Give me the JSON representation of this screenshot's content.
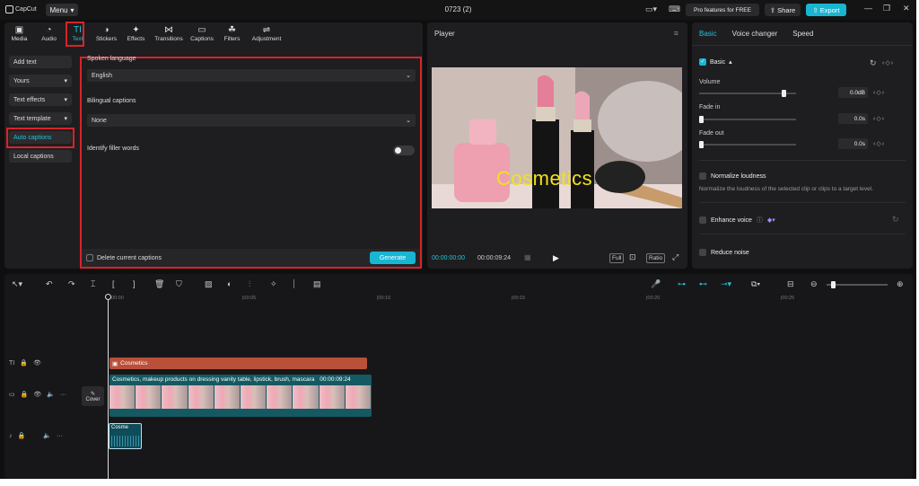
{
  "app": {
    "logo_text": "CapCut",
    "menu_label": "Menu",
    "doc_title": "0723 (2)"
  },
  "header": {
    "pro_label": "Pro features for FREE",
    "share_label": "Share",
    "export_label": "Export"
  },
  "tool_tabs": [
    {
      "label": "Media",
      "icon": "media-icon",
      "glyph": "▣"
    },
    {
      "label": "Audio",
      "icon": "audio-icon",
      "glyph": "◔"
    },
    {
      "label": "Text",
      "icon": "text-icon",
      "glyph": "TI"
    },
    {
      "label": "Stickers",
      "icon": "stickers-icon",
      "glyph": "◑"
    },
    {
      "label": "Effects",
      "icon": "effects-icon",
      "glyph": "✦"
    },
    {
      "label": "Transitions",
      "icon": "transitions-icon",
      "glyph": "⋈"
    },
    {
      "label": "Captions",
      "icon": "captions-icon",
      "glyph": "▭"
    },
    {
      "label": "Filters",
      "icon": "filters-icon",
      "glyph": "☘"
    },
    {
      "label": "Adjustment",
      "icon": "adjustment-icon",
      "glyph": "⇌"
    }
  ],
  "side_menu": [
    {
      "label": "Add text",
      "dropdown": false
    },
    {
      "label": "Yours",
      "dropdown": true
    },
    {
      "label": "Text effects",
      "dropdown": true
    },
    {
      "label": "Text template",
      "dropdown": true
    },
    {
      "label": "Auto captions",
      "dropdown": false,
      "active": true
    },
    {
      "label": "Local captions",
      "dropdown": false
    }
  ],
  "captions": {
    "spoken_label": "Spoken language",
    "spoken_value": "English",
    "bilingual_label": "Bilingual captions",
    "bilingual_value": "None",
    "filler_label": "Identify filler words",
    "delete_label": "Delete current captions",
    "generate_label": "Generate"
  },
  "player": {
    "title": "Player",
    "caption_text": "Cosmetics",
    "time_current": "00:00:00:00",
    "time_total": "00:00:09:24",
    "full_label": "Full",
    "ratio_label": "Ratio"
  },
  "right_panel": {
    "tabs": [
      "Basic",
      "Voice changer",
      "Speed"
    ],
    "basic_label": "Basic",
    "volume_label": "Volume",
    "volume_value": "0.0dB",
    "volume_level": 0.85,
    "fade_in_label": "Fade in",
    "fade_in_value": "0.0s",
    "fade_out_label": "Fade out",
    "fade_out_value": "0.0s",
    "normalize_label": "Normalize loudness",
    "normalize_desc": "Normalize the loudness of the selected clip or clips to a target level.",
    "enhance_label": "Enhance voice",
    "reduce_label": "Reduce noise"
  },
  "timeline": {
    "ticks": [
      "00:00",
      "|00:05",
      "|00:10",
      "|00:15",
      "|00:20",
      "|00:25"
    ],
    "text_clip_label": "Cosmetics",
    "video_clip_label": "Cosmetics, makeup products on dressing vanity table, lipstick, brush, mascara",
    "video_clip_duration": "00:00:09:24",
    "cover_label": "Cover",
    "audio_clip_label": "Cosme"
  },
  "colors": {
    "accent": "#19b6d2",
    "highlight": "#d8232a",
    "text_clip": "#b9503a",
    "video_clip": "#155a63"
  }
}
